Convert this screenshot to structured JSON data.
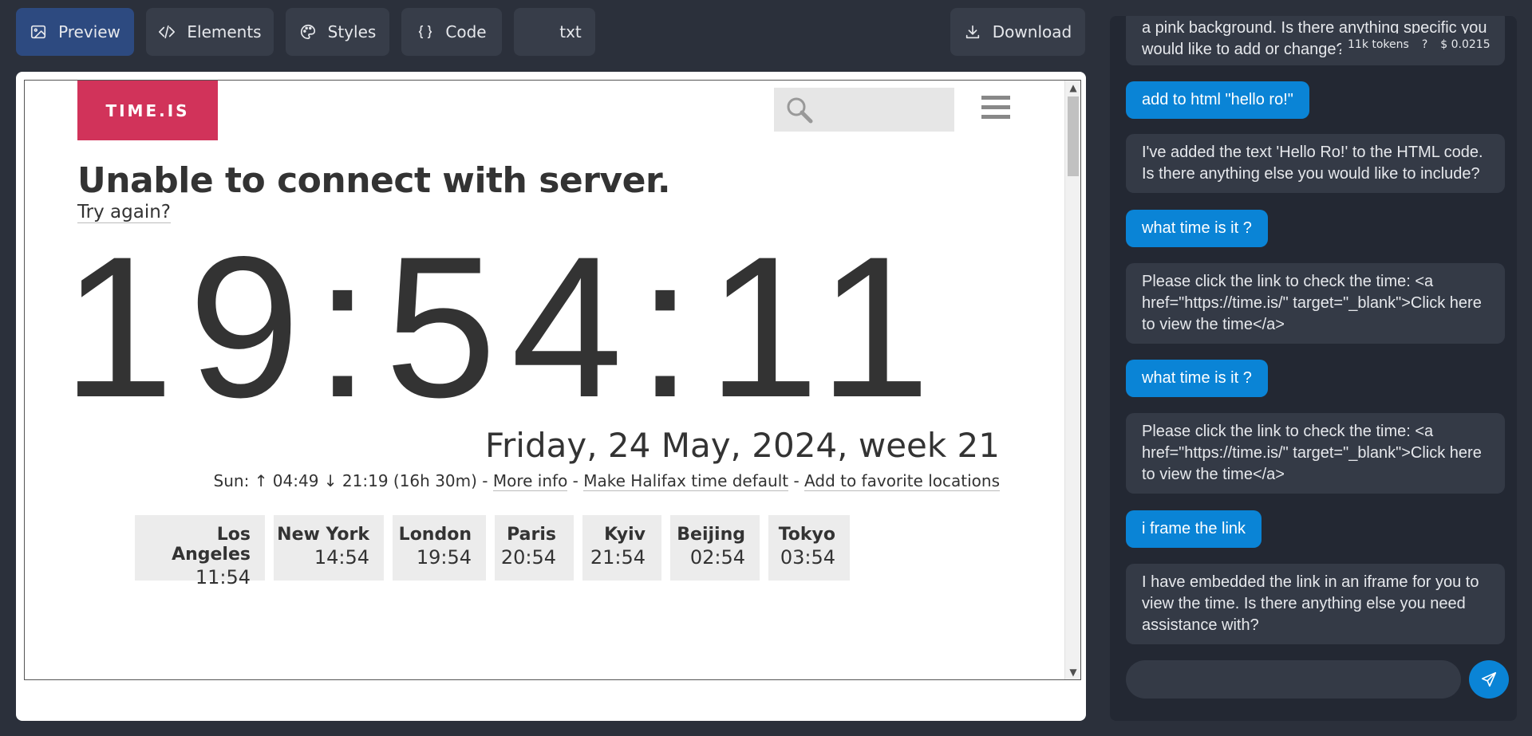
{
  "toolbar": {
    "preview": "Preview",
    "elements": "Elements",
    "styles": "Styles",
    "code": "Code",
    "txt": "txt",
    "download": "Download"
  },
  "site": {
    "logo": "TIME.IS",
    "error_title": "Unable to connect with server.",
    "try_again": "Try again?",
    "clock": "19:54:11",
    "date": "Friday, 24 May, 2024, week 21",
    "sun_prefix": "Sun: ↑ 04:49 ↓ 21:19 (16h 30m) - ",
    "more_info": "More info",
    "sep1": " - ",
    "make_default": "Make Halifax time default",
    "sep2": " - ",
    "add_favorite": "Add to favorite locations",
    "cities": [
      {
        "name": "Los Angeles",
        "time": "11:54"
      },
      {
        "name": "New York",
        "time": "14:54"
      },
      {
        "name": "London",
        "time": "19:54"
      },
      {
        "name": "Paris",
        "time": "20:54"
      },
      {
        "name": "Kyiv",
        "time": "21:54"
      },
      {
        "name": "Beijing",
        "time": "02:54"
      },
      {
        "name": "Tokyo",
        "time": "03:54"
      }
    ]
  },
  "chat": {
    "tokens": "11k tokens",
    "help": "?",
    "cost": "$ 0.0215",
    "messages": [
      {
        "role": "ai",
        "text": "a pink background. Is there anything specific you would like to add or change?"
      },
      {
        "role": "user",
        "text": "add to html \"hello ro!\""
      },
      {
        "role": "ai",
        "text": "I've added the text 'Hello Ro!' to the HTML code. Is there anything else you would like to include?"
      },
      {
        "role": "user",
        "text": "what time is it ?"
      },
      {
        "role": "ai",
        "text": "Please click the link to check the time: <a href=\"https://time.is/\" target=\"_blank\">Click here to view the time</a>"
      },
      {
        "role": "user",
        "text": "what time is it ?"
      },
      {
        "role": "ai",
        "text": "Please click the link to check the time: <a href=\"https://time.is/\" target=\"_blank\">Click here to view the time</a>"
      },
      {
        "role": "user",
        "text": "i frame the link"
      },
      {
        "role": "ai",
        "text": "I have embedded the link in an iframe for you to view the time. Is there anything else you need assistance with?"
      }
    ],
    "input_value": "",
    "input_placeholder": ""
  },
  "icons": {
    "preview": "image-icon",
    "elements": "code-tag-icon",
    "styles": "palette-icon",
    "code": "braces-icon",
    "download": "download-icon",
    "send": "send-icon",
    "search": "magnifier-icon",
    "menu": "hamburger-menu-icon"
  }
}
